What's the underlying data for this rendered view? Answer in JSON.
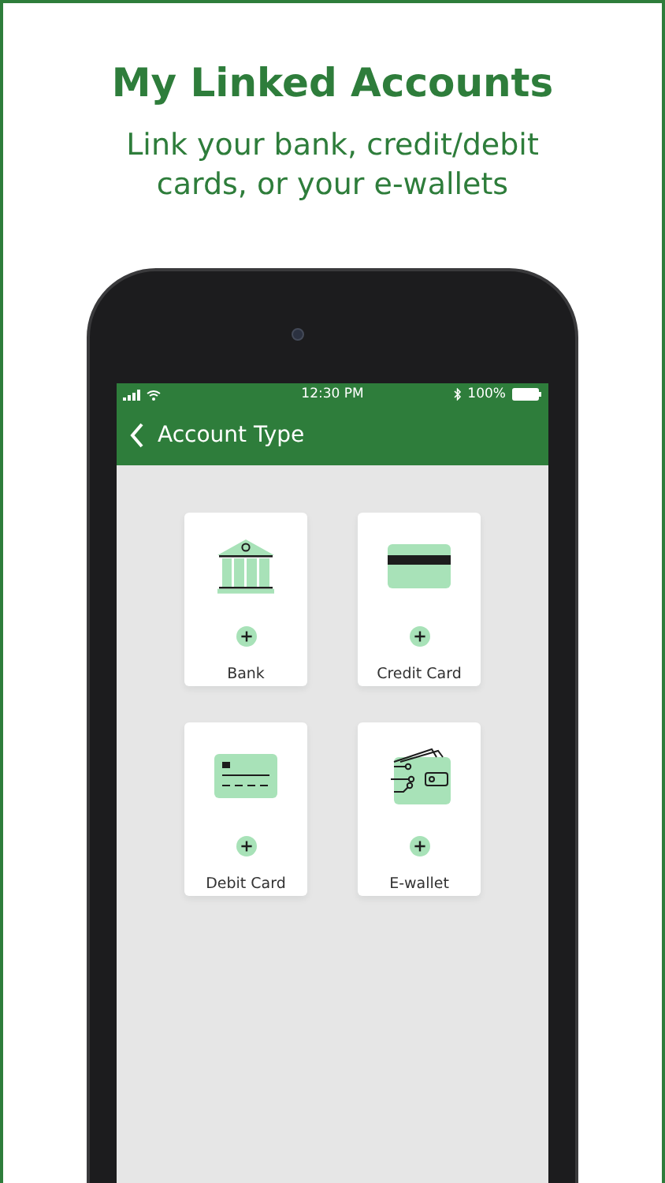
{
  "headline": "My Linked Accounts",
  "subtitle": "Link your bank, credit/debit cards, or your e-wallets",
  "status_bar": {
    "time": "12:30 PM",
    "battery": "100%"
  },
  "app_bar": {
    "title": "Account Type"
  },
  "account_types": [
    {
      "kind": "bank",
      "label": "Bank"
    },
    {
      "kind": "credit",
      "label": "Credit Card"
    },
    {
      "kind": "debit",
      "label": "Debit Card"
    },
    {
      "kind": "ewallet",
      "label": "E-wallet"
    }
  ]
}
